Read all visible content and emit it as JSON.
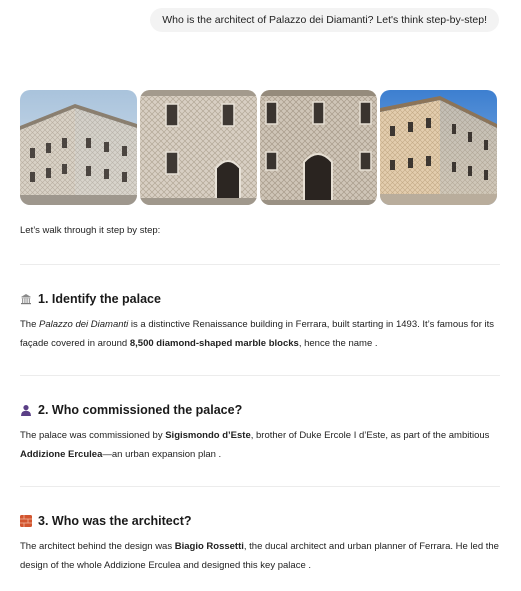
{
  "user_message": "Who is the architect of Palazzo dei Diamanti? Let's think step-by-step!",
  "images": [
    {
      "icon": "palazzo-corner-photo"
    },
    {
      "icon": "palazzo-facade-photo"
    },
    {
      "icon": "palazzo-entrance-photo"
    },
    {
      "icon": "palazzo-corner-sunset-photo"
    }
  ],
  "intro": "Let’s walk through it step by step:",
  "sections": [
    {
      "icon": "classical-building-emoji",
      "title": "1. Identify the palace",
      "p1_italic": "Palazzo dei Diamanti",
      "p1_a": "The ",
      "p1_b": " is a distinctive Renaissance building in Ferrara, built starting in 1493. It’s famous for its façade covered in around ",
      "p1_bold": "8,500 diamond-shaped marble blocks",
      "p1_c": ", hence the name ."
    },
    {
      "icon": "bust-in-silhouette-emoji",
      "title": "2. Who commissioned the palace?",
      "p_a": "The palace was commissioned by ",
      "p_bold1": "Sigismondo d’Este",
      "p_b": ", brother of Duke Ercole I d’Este, as part of the ambitious ",
      "p_bold2": "Addizione Erculea",
      "p_c": "—an urban expansion plan ."
    },
    {
      "icon": "brick-emoji",
      "title": "3. Who was the architect?",
      "p_a": "The architect behind the design was ",
      "p_bold": "Biagio Rossetti",
      "p_b": ", the ducal architect and urban planner of Ferrara. He led the design of the whole Addizione Erculea and designed this key palace ."
    }
  ],
  "colors": {
    "user_bubble_bg": "#f3f3f3",
    "divider": "#ececec",
    "text": "#222222"
  }
}
